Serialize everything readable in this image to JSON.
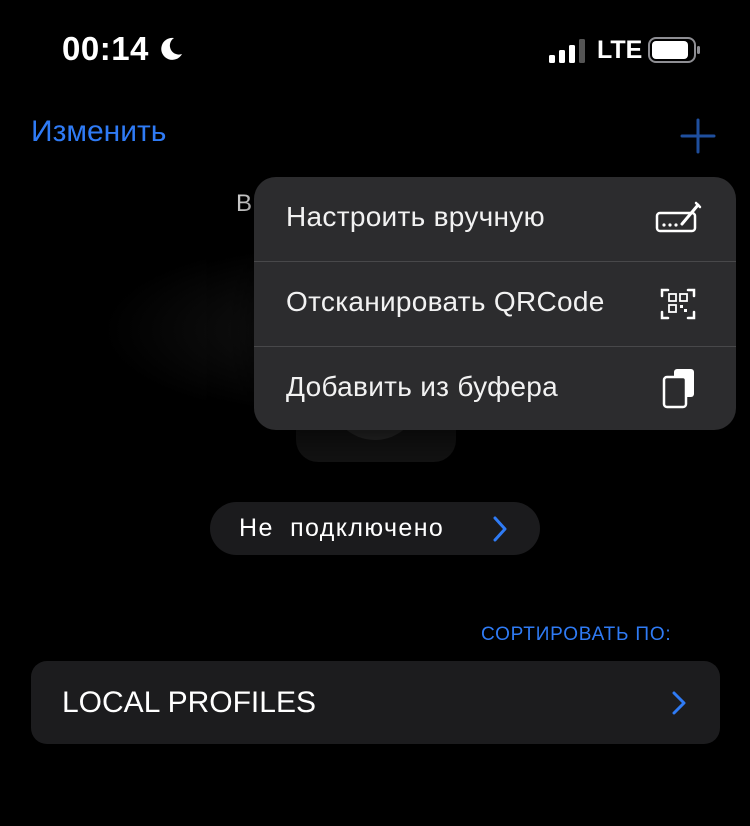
{
  "status_bar": {
    "time": "00:14",
    "network": "LTE",
    "signal_bars": 3,
    "signal_bars_total": 4,
    "icons": [
      "moon-icon",
      "signal-icon",
      "battery-icon"
    ]
  },
  "nav": {
    "edit_label": "Изменить",
    "add_icon": "plus-icon"
  },
  "background_text": "В",
  "menu": {
    "items": [
      {
        "label": "Настроить вручную",
        "icon": "edit-form-icon"
      },
      {
        "label": "Отсканировать QRCode",
        "icon": "qr-code-scan-icon"
      },
      {
        "label": "Добавить из буфера",
        "icon": "clipboard-icon"
      }
    ]
  },
  "connection": {
    "status_label": "Не подключено",
    "icon": "chevron-right-icon"
  },
  "sort": {
    "label": "СОРТИРОВАТЬ ПО:"
  },
  "profiles": {
    "label": "LOCAL PROFILES",
    "icon": "chevron-right-icon"
  },
  "colors": {
    "accent": "#2f7bf5",
    "background": "#000000",
    "menu_bg": "#2c2c2e",
    "row_bg": "#1c1c1e"
  }
}
